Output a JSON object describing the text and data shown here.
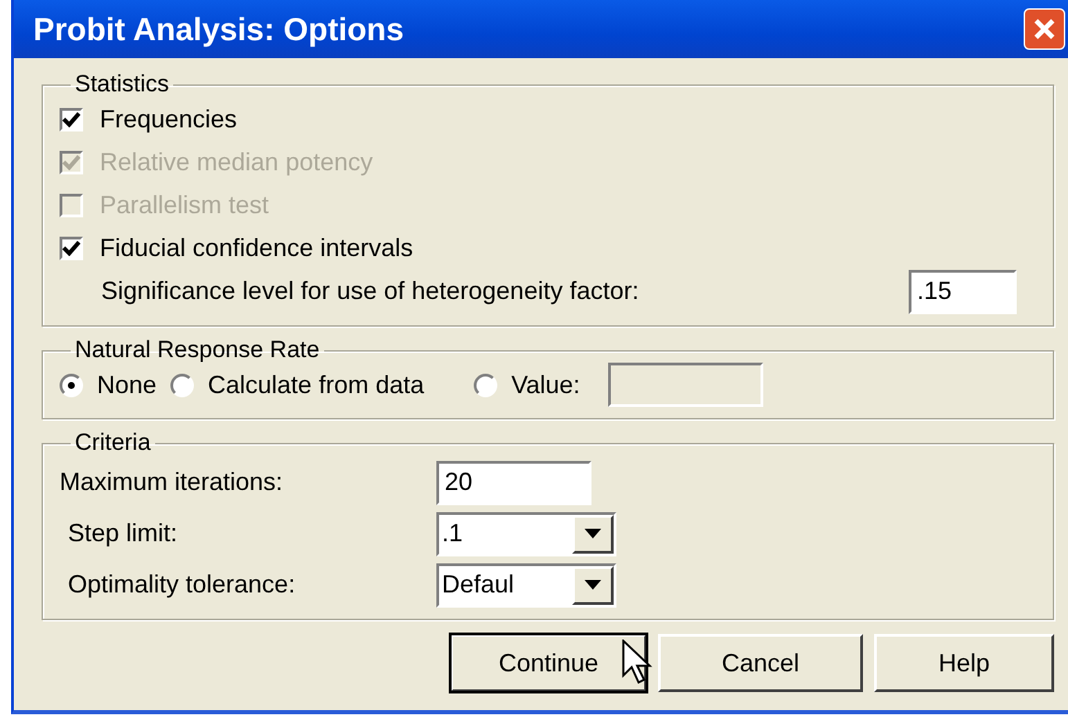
{
  "window": {
    "title": "Probit Analysis: Options"
  },
  "statistics": {
    "label": "Statistics",
    "options": [
      {
        "label": "Frequencies",
        "checked": true,
        "disabled": false
      },
      {
        "label": "Relative median potency",
        "checked": true,
        "disabled": true
      },
      {
        "label": "Parallelism test",
        "checked": false,
        "disabled": true
      },
      {
        "label": "Fiducial confidence intervals",
        "checked": true,
        "disabled": false
      }
    ],
    "significance": {
      "label": "Significance level for use of heterogeneity factor:",
      "value": ".15"
    }
  },
  "natural_response_rate": {
    "label": "Natural Response Rate",
    "options": [
      {
        "label": "None",
        "selected": true
      },
      {
        "label": "Calculate from data",
        "selected": false
      },
      {
        "label": "Value:",
        "selected": false
      }
    ],
    "value_field": {
      "disabled": true
    }
  },
  "criteria": {
    "label": "Criteria",
    "fields": [
      {
        "label": "Maximum iterations:",
        "kind": "text",
        "value": "20"
      },
      {
        "label": "Step limit:",
        "kind": "dropdown",
        "value": ".1"
      },
      {
        "label": "Optimality tolerance:",
        "kind": "dropdown",
        "value": "Defaul"
      }
    ]
  },
  "buttons": [
    {
      "label": "Continue",
      "default": true
    },
    {
      "label": "Cancel",
      "default": false
    },
    {
      "label": "Help",
      "default": false
    }
  ]
}
